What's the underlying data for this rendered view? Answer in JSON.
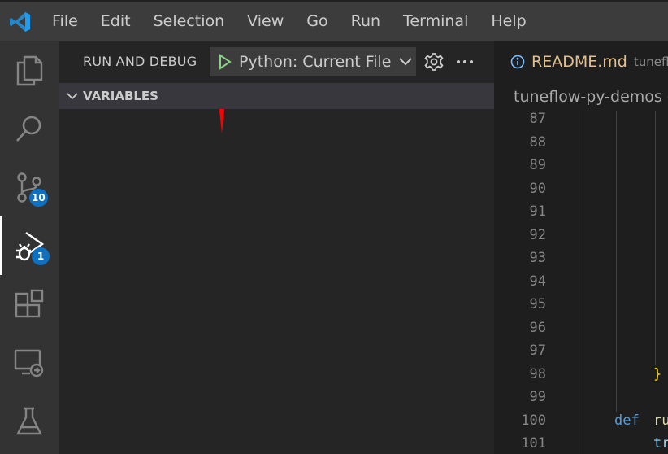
{
  "menu": {
    "items": [
      "File",
      "Edit",
      "Selection",
      "View",
      "Go",
      "Run",
      "Terminal",
      "Help"
    ]
  },
  "activity_bar": {
    "items": [
      {
        "name": "explorer",
        "icon": "files-icon"
      },
      {
        "name": "search",
        "icon": "search-icon"
      },
      {
        "name": "source-control",
        "icon": "source-control-icon",
        "badge": "10"
      },
      {
        "name": "run-and-debug",
        "icon": "run-debug-icon",
        "badge": "1",
        "active": true
      },
      {
        "name": "extensions",
        "icon": "extensions-icon"
      },
      {
        "name": "remote-explorer",
        "icon": "remote-explorer-icon"
      },
      {
        "name": "testing",
        "icon": "flask-icon"
      }
    ]
  },
  "sidebar": {
    "title": "RUN AND DEBUG",
    "launch_config": "Python: Current File",
    "section": "VARIABLES"
  },
  "editor": {
    "tab_label": "README.md",
    "tab_description": "tuneflo",
    "breadcrumb": "tuneflow-py-demos",
    "line_numbers": [
      "87",
      "88",
      "89",
      "90",
      "91",
      "92",
      "93",
      "94",
      "95",
      "96",
      "97",
      "98",
      "99",
      "100",
      "101"
    ],
    "code_brace": "}",
    "code_def": "def",
    "code_fn": "ru",
    "code_tr": "tr"
  },
  "colors": {
    "accent": "#0e70c0",
    "play": "#89d185",
    "arrow": "#ff0000",
    "readme": "#e2c08d",
    "keyword": "#569cd6",
    "brace": "#ffd700",
    "function": "#dcdcaa",
    "variable": "#9cdcfe"
  }
}
